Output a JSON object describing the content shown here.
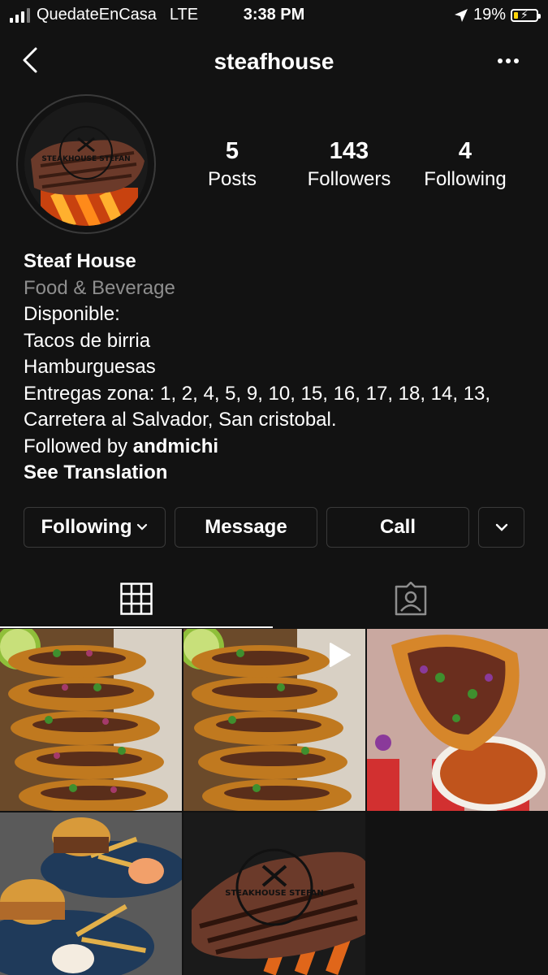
{
  "status_bar": {
    "carrier": "QuedateEnCasa",
    "network": "LTE",
    "time": "3:38 PM",
    "battery": "19%",
    "battery_level": 0.19
  },
  "header": {
    "username": "steafhouse"
  },
  "stats": {
    "posts_count": "5",
    "posts_label": "Posts",
    "followers_count": "143",
    "followers_label": "Followers",
    "following_count": "4",
    "following_label": "Following"
  },
  "bio": {
    "name": "Steaf House",
    "category": "Food & Beverage",
    "lines": [
      "Disponible:",
      "Tacos de birria",
      "Hamburguesas",
      "Entregas zona: 1, 2, 4, 5, 9, 10, 15, 16, 17, 18, 14, 13,",
      "Carretera al Salvador, San cristobal."
    ],
    "followed_by_prefix": "Followed by ",
    "followed_by_user": "andmichi",
    "see_translation": "See Translation"
  },
  "actions": {
    "following": "Following",
    "message": "Message",
    "call": "Call"
  },
  "logo_text": "STEAKHOUSE STEFAN",
  "colors": {
    "background": "#121212",
    "text": "#ffffff",
    "muted": "#8e8e8e",
    "border": "#3a3a3a",
    "battery_low": "#ffd60a"
  },
  "icons": [
    "back-arrow-icon",
    "more-dots-icon",
    "grid-icon",
    "tagged-icon",
    "chevron-down-icon",
    "play-icon",
    "location-arrow-icon"
  ]
}
